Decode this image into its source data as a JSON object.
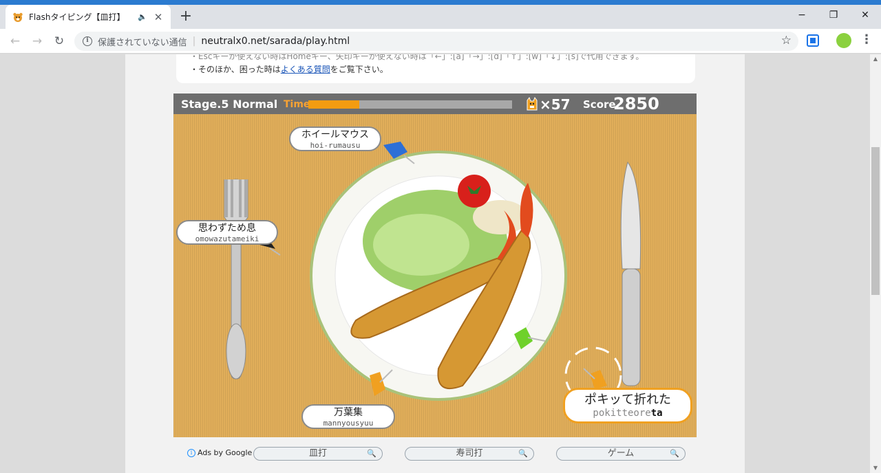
{
  "browser": {
    "tab_title": "Flashタイピング【皿打】",
    "audio_glyph": "🔈",
    "close_glyph": "✕",
    "new_tab_glyph": "+",
    "window_controls": {
      "minimize": "−",
      "maximize": "❐",
      "close": "✕"
    },
    "nav": {
      "back": "←",
      "forward": "→",
      "reload": "↻"
    },
    "security_text": "保護されていない通信",
    "separator": "|",
    "url": "neutralx0.net/sarada/play.html",
    "star_glyph": "☆",
    "menu_glyph": "⋮",
    "profile_color": "#8bd13f"
  },
  "notice": {
    "line1_cut": "・Escキーが使えない時はHomeキー、矢印キーが使えない時は「←」:[a]「→」:[d]「↑」:[w]「↓」:[s]で代用できます。",
    "line2_prefix": "・そのほか、困った時は",
    "line2_link": "よくある質問",
    "line2_suffix": "をご覧下さい。"
  },
  "hud": {
    "stage": "Stage.5",
    "difficulty": "Normal",
    "time_label": "Time",
    "time_remaining": 0.25,
    "lives_prefix": "×",
    "lives": "57",
    "score_label": "Score",
    "score": "2850",
    "accent_color": "#f39c11"
  },
  "words": {
    "w1": {
      "jp": "ホイールマウス",
      "ro": "hoi-rumausu"
    },
    "w2": {
      "jp": "思わずため息",
      "ro": "omowazutameiki"
    },
    "w3": {
      "jp": "万葉集",
      "ro": "mannyousyuu"
    },
    "active": {
      "jp": "ポキッて折れた",
      "ro_typed": "pokitteore",
      "ro_rest": "ta"
    }
  },
  "ads": {
    "info_glyph": "i",
    "label": "Ads by Google",
    "search_icon": "🔍",
    "searches": [
      "皿打",
      "寿司打",
      "ゲーム"
    ]
  }
}
